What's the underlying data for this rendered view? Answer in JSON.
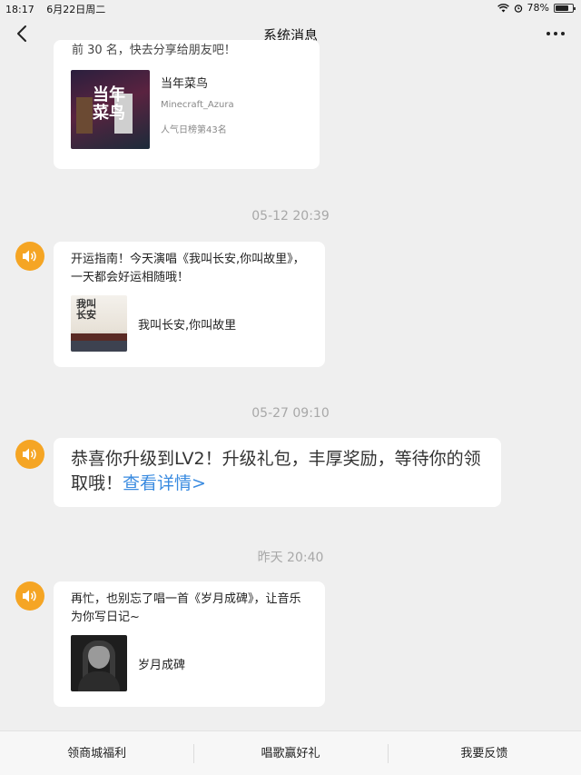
{
  "status": {
    "time": "18:17",
    "date": "6月22日周二",
    "battery": "78%",
    "battery_level": 0.78
  },
  "nav": {
    "title": "系统消息"
  },
  "msg1": {
    "partial_text": "前 30 名，快去分享给朋友吧！",
    "song_title": "当年菜鸟",
    "artist": "Minecraft_Azura",
    "rank": "人气日榜第43名",
    "thumb_text": "当年菜鸟"
  },
  "msg2": {
    "timestamp": "05-12 20:39",
    "text": "开运指南！今天演唱《我叫长安,你叫故里》，一天都会好运相随哦！",
    "song_title": "我叫长安,你叫故里",
    "thumb_text": "我叫长安"
  },
  "msg3": {
    "timestamp": "05-27 09:10",
    "text": "恭喜你升级到LV2！升级礼包，丰厚奖励，等待你的领取哦！",
    "link": "查看详情>"
  },
  "msg4": {
    "timestamp": "昨天 20:40",
    "text": "再忙，也别忘了唱一首《岁月成碑》，让音乐为你写日记~",
    "song_title": "岁月成碑"
  },
  "bottom": {
    "tabs": [
      "领商城福利",
      "唱歌赢好礼",
      "我要反馈"
    ]
  },
  "colors": {
    "accent": "#f5a524",
    "link": "#3a8be0"
  }
}
